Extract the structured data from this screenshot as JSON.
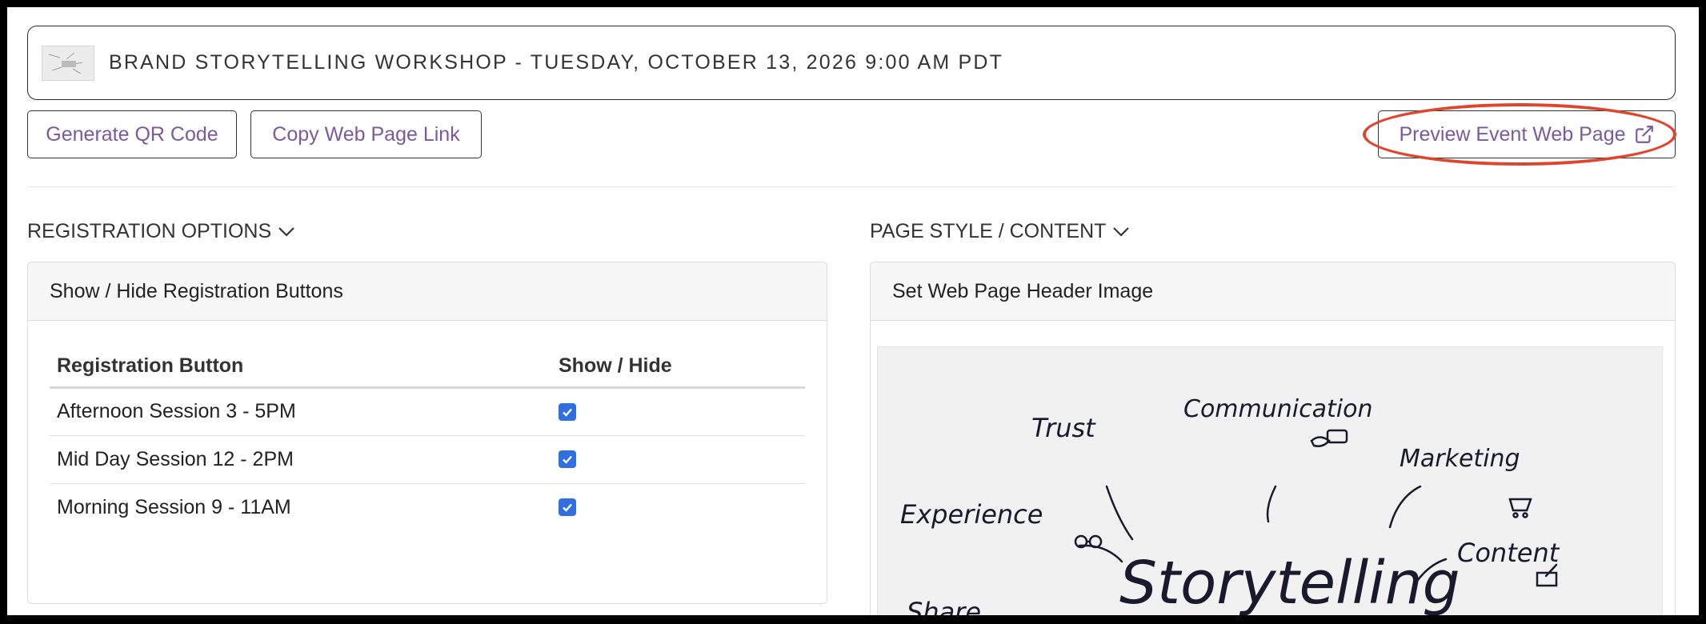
{
  "event": {
    "title": "BRAND STORYTELLING WORKSHOP - TUESDAY, OCTOBER 13, 2026 9:00 AM PDT"
  },
  "actions": {
    "generate_qr": "Generate QR Code",
    "copy_link": "Copy Web Page Link",
    "preview": "Preview Event Web Page"
  },
  "sections": {
    "registration": {
      "heading": "REGISTRATION OPTIONS",
      "panel_title": "Show / Hide Registration Buttons",
      "columns": [
        "Registration Button",
        "Show / Hide"
      ],
      "rows": [
        {
          "label": "Afternoon Session 3 - 5PM",
          "checked": true
        },
        {
          "label": "Mid Day Session 12 - 2PM",
          "checked": true
        },
        {
          "label": "Morning Session 9 - 11AM",
          "checked": true
        }
      ]
    },
    "page_style": {
      "heading": "PAGE STYLE / CONTENT",
      "panel_title": "Set Web Page Header Image",
      "image_words": {
        "main": "Storytelling",
        "communication": "Communication",
        "trust": "Trust",
        "marketing": "Marketing",
        "experience": "Experience",
        "content": "Content",
        "share": "Share"
      }
    }
  },
  "colors": {
    "link_purple": "#7b5a9c",
    "highlight_red": "#e0452c",
    "checkbox_blue": "#2f6fe0"
  },
  "icons": {
    "chevron": "chevron-down-icon",
    "external": "external-link-icon",
    "check": "checkmark-icon"
  }
}
